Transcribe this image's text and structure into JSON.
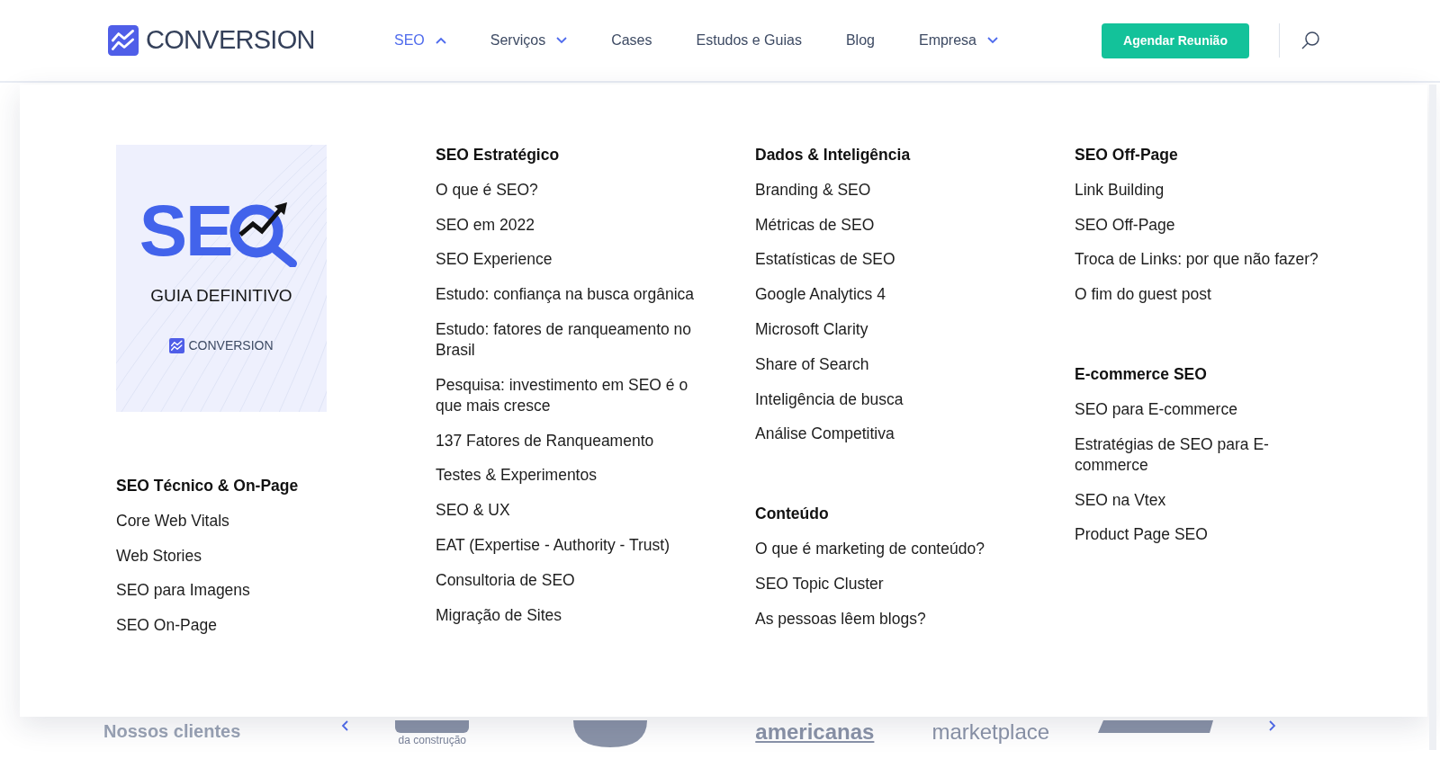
{
  "header": {
    "brand": "CONVERSION",
    "nav": [
      {
        "label": "SEO",
        "dropdown": true,
        "selected": true
      },
      {
        "label": "Serviços",
        "dropdown": true,
        "selected": false
      },
      {
        "label": "Cases",
        "dropdown": false,
        "selected": false
      },
      {
        "label": "Estudos e Guias",
        "dropdown": false,
        "selected": false
      },
      {
        "label": "Blog",
        "dropdown": false,
        "selected": false
      },
      {
        "label": "Empresa",
        "dropdown": true,
        "selected": false
      }
    ],
    "cta": "Agendar Reunião"
  },
  "mega_menu": {
    "guide_card": {
      "title": "SE",
      "subtitle": "GUIA DEFINITIVO",
      "brand": "CONVERSION"
    },
    "columns": [
      {
        "groups": [
          {
            "heading": "SEO Técnico & On-Page",
            "items": [
              "Core Web Vitals",
              "Web Stories",
              "SEO para Imagens",
              "SEO On-Page"
            ]
          }
        ]
      },
      {
        "groups": [
          {
            "heading": "SEO Estratégico",
            "items": [
              "O que é SEO?",
              "SEO em 2022",
              "SEO Experience",
              "Estudo: confiança na busca orgânica",
              "Estudo: fatores de ranqueamento no Brasil",
              "Pesquisa: investimento em SEO é o que mais cresce",
              "137 Fatores de Ranqueamento",
              "Testes & Experimentos",
              "SEO & UX",
              "EAT (Expertise - Authority - Trust)",
              "Consultoria de SEO",
              "Migração de Sites"
            ]
          }
        ]
      },
      {
        "groups": [
          {
            "heading": "Dados & Inteligência",
            "items": [
              "Branding & SEO",
              "Métricas de SEO",
              "Estatísticas de SEO",
              "Google Analytics 4",
              "Microsoft Clarity",
              "Share of Search",
              "Inteligência de busca",
              "Análise Competitiva"
            ]
          },
          {
            "heading": "Conteúdo",
            "items": [
              "O que é marketing de conteúdo?",
              "SEO Topic Cluster",
              "As pessoas lêem blogs?"
            ]
          }
        ]
      },
      {
        "groups": [
          {
            "heading": "SEO Off-Page",
            "items": [
              "Link Building",
              "SEO Off-Page",
              "Troca de Links: por que não fazer?",
              "O fim do guest post"
            ]
          },
          {
            "heading": "E-commerce SEO",
            "items": [
              "SEO para E-commerce",
              "Estratégias de SEO para E-commerce",
              "SEO na Vtex",
              "Product Page SEO"
            ]
          }
        ]
      }
    ]
  },
  "clients": {
    "title": "Nossos clientes",
    "logos": [
      {
        "kind": "mark",
        "caption": "da construção"
      },
      {
        "kind": "blob"
      },
      {
        "kind": "word",
        "text": "americanas"
      },
      {
        "kind": "word",
        "text": "marketplace"
      },
      {
        "kind": "italic"
      }
    ]
  }
}
